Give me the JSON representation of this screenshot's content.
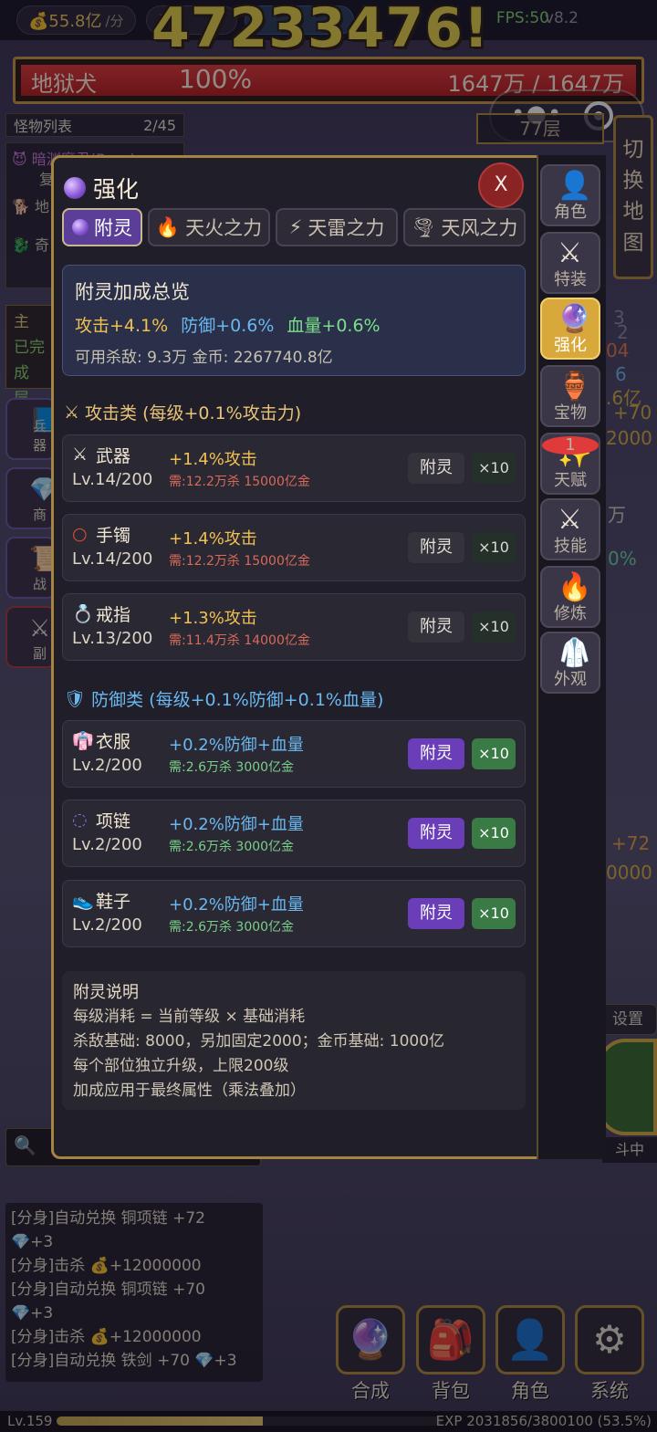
{
  "topbar": {
    "gold": "💰55.8亿",
    "gold_unit": "/分",
    "fps": "FPS:50",
    "version": "v8.2"
  },
  "damage_popup": "47233476!",
  "boss": {
    "name": "地狱犬",
    "hp_percent": "100%",
    "hp_text": "1647万 / 1647万"
  },
  "monster_list": {
    "title": "怪物列表",
    "count": "2/45",
    "rows": [
      "暗渊魔君(Boss)",
      "复",
      "地",
      "奇"
    ]
  },
  "quest": {
    "line1": "主",
    "line2": "已完成",
    "line3": "层"
  },
  "left_buttons": [
    "兵器",
    "商",
    "战",
    "副"
  ],
  "floor_label": "77层",
  "map_button": [
    "切",
    "换",
    "地",
    "图"
  ],
  "right_peek": [
    "3",
    "2",
    "04",
    "6",
    ".6亿",
    "+70",
    "2000",
    "万",
    "0%",
    "+72",
    "0000"
  ],
  "settings_label": "设置",
  "fight_label": "斗中",
  "search_label": "🔍",
  "log": [
    "[分身]自动兑换 铜项链 +72",
    "💎+3",
    "[分身]击杀 💰+12000000",
    "[分身]自动兑换 铜项链 +70",
    "💎+3",
    "[分身]击杀 💰+12000000",
    "[分身]自动兑换 铁剑 +70 💎+3"
  ],
  "nav": [
    {
      "label": "合成",
      "icon": "crystal-ball-icon"
    },
    {
      "label": "背包",
      "icon": "backpack-icon"
    },
    {
      "label": "角色",
      "icon": "person-icon"
    },
    {
      "label": "系统",
      "icon": "gear-icon"
    }
  ],
  "exp": {
    "level": "Lv.159",
    "text": "EXP 2031856/3800100 (53.5%)",
    "progress": 0.535
  },
  "modal": {
    "title": "强化",
    "close": "X",
    "tabs": [
      "附灵",
      "天火之力",
      "天雷之力",
      "天风之力"
    ],
    "summary": {
      "title": "附灵加成总览",
      "attack": "攻击+4.1%",
      "defense": "防御+0.6%",
      "hp": "血量+0.6%",
      "sub": "可用杀敌: 9.3万   金币: 2267740.8亿"
    },
    "attack_section": "攻击类 (每级+0.1%攻击力)",
    "defense_section": "防御类 (每级+0.1%防御+0.1%血量)",
    "attack_items": [
      {
        "name": "武器",
        "level": "Lv.14/200",
        "effect": "+1.4%攻击",
        "need": "需:12.2万杀 15000亿金"
      },
      {
        "name": "手镯",
        "level": "Lv.14/200",
        "effect": "+1.4%攻击",
        "need": "需:12.2万杀 15000亿金"
      },
      {
        "name": "戒指",
        "level": "Lv.13/200",
        "effect": "+1.3%攻击",
        "need": "需:11.4万杀 14000亿金"
      }
    ],
    "defense_items": [
      {
        "name": "衣服",
        "level": "Lv.2/200",
        "effect": "+0.2%防御+血量",
        "need": "需:2.6万杀 3000亿金"
      },
      {
        "name": "项链",
        "level": "Lv.2/200",
        "effect": "+0.2%防御+血量",
        "need": "需:2.6万杀 3000亿金"
      },
      {
        "name": "鞋子",
        "level": "Lv.2/200",
        "effect": "+0.2%防御+血量",
        "need": "需:2.6万杀 3000亿金"
      }
    ],
    "enchant_label": "附灵",
    "x10_label": "×10",
    "help": {
      "title": "附灵说明",
      "lines": [
        "每级消耗 = 当前等级 × 基础消耗",
        "杀敌基础: 8000，另加固定2000；金币基础: 1000亿",
        "每个部位独立升级，上限200级",
        "加成应用于最终属性（乘法叠加）"
      ]
    },
    "side_menu": [
      {
        "label": "角色",
        "icon": "person-icon"
      },
      {
        "label": "特装",
        "icon": "crossed-swords-icon"
      },
      {
        "label": "强化",
        "icon": "crystal-ball-icon",
        "active": true
      },
      {
        "label": "宝物",
        "icon": "treasure-jar-icon"
      },
      {
        "label": "天赋",
        "icon": "sparkles-icon",
        "badge": "1"
      },
      {
        "label": "技能",
        "icon": "crossed-swords-icon"
      },
      {
        "label": "修炼",
        "icon": "fire-icon"
      },
      {
        "label": "外观",
        "icon": "robe-icon"
      }
    ]
  },
  "colors": {
    "accent": "#a48440",
    "active_tab": "#5a3e98",
    "boss_hp": "#d42a2a",
    "attack": "#f0c050",
    "defense": "#6ab8f0",
    "hp": "#7ae08a"
  }
}
